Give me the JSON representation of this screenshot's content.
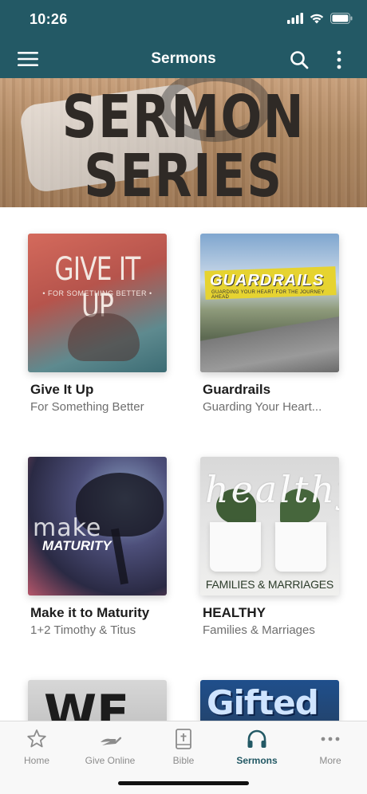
{
  "status_bar": {
    "time": "10:26"
  },
  "app_bar": {
    "title": "Sermons"
  },
  "hero": {
    "line1": "SERMON",
    "line2": "SERIES"
  },
  "series": [
    {
      "title": "Give It Up",
      "subtitle": "For Something Better",
      "art_title": "GIVE IT UP",
      "art_subtitle": "• FOR SOMETHING BETTER •"
    },
    {
      "title": "Guardrails",
      "subtitle": "Guarding Your Heart...",
      "art_title": "GUARDRAILS",
      "art_subtitle": "GUARDING YOUR HEART FOR THE JOURNEY AHEAD"
    },
    {
      "title": "Make it to Maturity",
      "subtitle": "1+2 Timothy & Titus",
      "art_title": "make",
      "art_subtitle": "MATURITY"
    },
    {
      "title": "HEALTHY",
      "subtitle": "Families & Marriages",
      "art_title": "healthy",
      "art_subtitle": "FAMILIES & MARRIAGES"
    },
    {
      "art_title": "WE"
    },
    {
      "art_title": "Gifted"
    }
  ],
  "tabs": [
    {
      "label": "Home",
      "icon": "star-icon",
      "active": false
    },
    {
      "label": "Give Online",
      "icon": "giving-hand-icon",
      "active": false
    },
    {
      "label": "Bible",
      "icon": "bible-icon",
      "active": false
    },
    {
      "label": "Sermons",
      "icon": "headphones-icon",
      "active": true
    },
    {
      "label": "More",
      "icon": "more-dots-icon",
      "active": false
    }
  ],
  "colors": {
    "primary": "#235965",
    "tab_inactive": "#8c8c8c"
  }
}
